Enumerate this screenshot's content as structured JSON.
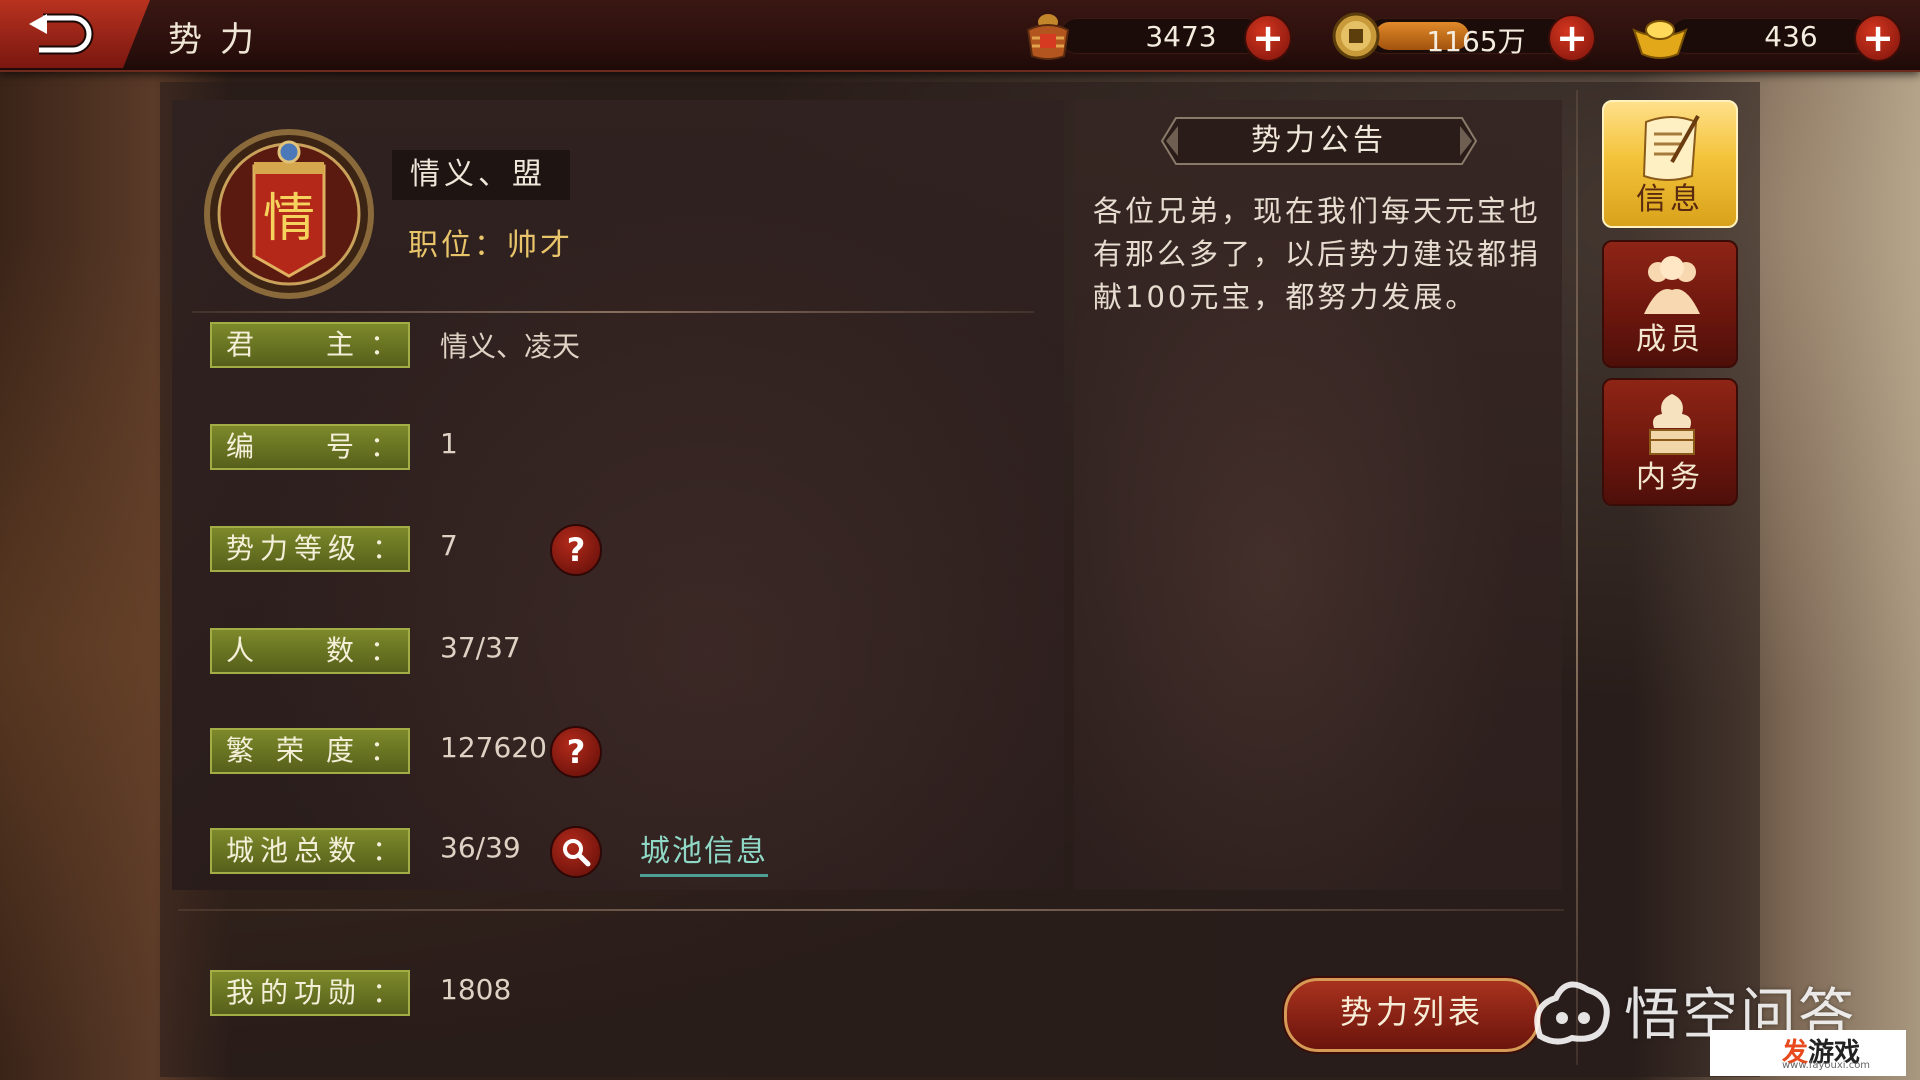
{
  "header": {
    "title": "势力",
    "resources": [
      {
        "icon": "grain-basket-icon",
        "value": "3473"
      },
      {
        "icon": "copper-coin-icon",
        "value": "1165万"
      },
      {
        "icon": "gold-ingot-icon",
        "value": "436"
      }
    ],
    "plus_label": "+"
  },
  "alliance": {
    "emblem_char": "情",
    "name": "情义、盟",
    "position": "职位：帅才"
  },
  "info_rows": [
    {
      "label": "君主",
      "value": "情义、凌天"
    },
    {
      "label": "编号",
      "value": "1"
    },
    {
      "label": "势力等级",
      "value": "7"
    },
    {
      "label": "人数",
      "value": "37/37"
    },
    {
      "label": "繁荣度",
      "value": "127620"
    },
    {
      "label": "城池总数",
      "value": "36/39"
    }
  ],
  "colon": "：",
  "help_glyph": "?",
  "city_info_link": "城池信息",
  "merit": {
    "label": "我的功勋",
    "value": "1808"
  },
  "notice": {
    "title": "势力公告",
    "text": "各位兄弟，现在我们每天元宝也有那么多了，以后势力建设都捐献100元宝，都努力发展。"
  },
  "side_tabs": [
    {
      "label": "信息",
      "icon": "scroll-quill-icon",
      "active": true
    },
    {
      "label": "成员",
      "icon": "members-icon",
      "active": false
    },
    {
      "label": "内务",
      "icon": "treasure-beast-icon",
      "active": false
    }
  ],
  "alliance_list_button": "势力列表",
  "watermark": "悟空问答",
  "corner_logo": {
    "brand_a": "发",
    "brand_b": "游戏",
    "url": "www.fayouxi.com"
  },
  "colors": {
    "accent_gold": "#f3c33a",
    "label_olive": "#6d7a24",
    "button_red": "#a8321e",
    "link_teal": "#8fd8c6"
  }
}
